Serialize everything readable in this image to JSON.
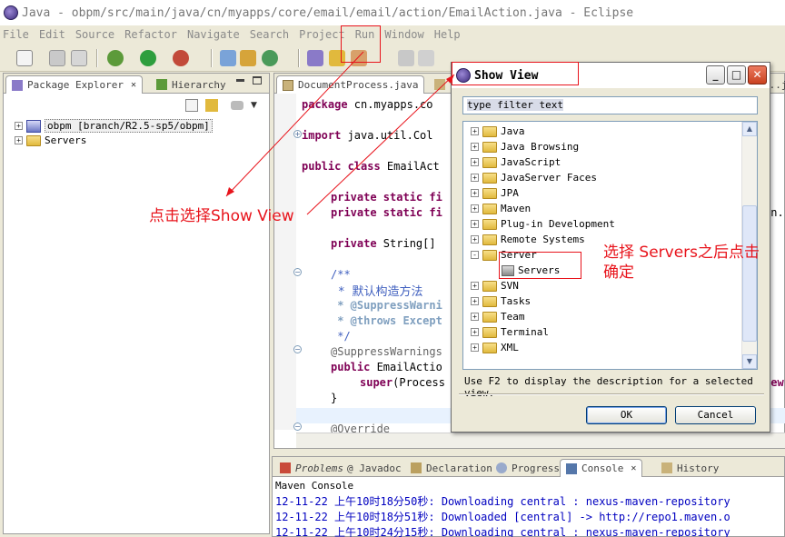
{
  "window": {
    "title": "Java - obpm/src/main/java/cn/myapps/core/email/email/action/EmailAction.java - Eclipse"
  },
  "menu": [
    "File",
    "Edit",
    "Source",
    "Refactor",
    "Navigate",
    "Search",
    "Project",
    "Run",
    "Window",
    "Help"
  ],
  "left_panel": {
    "tabs": [
      {
        "label": "Package Explorer",
        "active": true
      },
      {
        "label": "Hierarchy",
        "active": false
      }
    ],
    "tree": [
      {
        "label": "obpm [branch/R2.5-sp5/obpm]",
        "icon": "project-icon"
      },
      {
        "label": "Servers",
        "icon": "folder-icon"
      }
    ]
  },
  "editor": {
    "tabs": [
      {
        "label": "DocumentProcess.java"
      },
      {
        "label": "E..."
      },
      {
        "label": "...j"
      }
    ],
    "code": {
      "l1_kw": "package",
      "l1": " cn.myapps.co",
      "l2_kw": "import",
      "l2": " java.util.Col",
      "l3_kw": "public class",
      "l3": " EmailAct",
      "l4_kw": "private static fi",
      "l5_kw": "private static fi",
      "l5_tail": "on.",
      "l6_kw": "private",
      "l6": " String[]",
      "l7": "/**",
      "l8": " * 默认构造方法",
      "l9_tag": " * @SuppressWarni",
      "l10_tag": " * @throws Except",
      "l11": " */",
      "l12": "@SuppressWarnings",
      "l13_kw": "public",
      "l13": " EmailActio",
      "l14_kw": "super",
      "l14": "(Process",
      "l14_tail": "new",
      "l15": "}",
      "l16": "@Override"
    }
  },
  "bottom_panel": {
    "tabs": [
      "Problems",
      "@ Javadoc",
      "Declaration",
      "Progress",
      "Console",
      "History"
    ],
    "console_title": "Maven Console",
    "lines": [
      "12-11-22 上午10时18分50秒: Downloading central : nexus-maven-repository",
      "12-11-22 上午10时18分51秒: Downloaded [central] -> http://repo1.maven.o",
      "12-11-22 上午10时24分15秒: Downloading central : nexus-maven-repository"
    ]
  },
  "dialog": {
    "title": "Show View",
    "filter_text": "type filter text",
    "items": [
      {
        "label": "Java",
        "expander": "+"
      },
      {
        "label": "Java Browsing",
        "expander": "+"
      },
      {
        "label": "JavaScript",
        "expander": "+"
      },
      {
        "label": "JavaServer Faces",
        "expander": "+"
      },
      {
        "label": "JPA",
        "expander": "+"
      },
      {
        "label": "Maven",
        "expander": "+"
      },
      {
        "label": "Plug-in Development",
        "expander": "+"
      },
      {
        "label": "Remote Systems",
        "expander": "+"
      },
      {
        "label": "Server",
        "expander": "-"
      },
      {
        "label": "Servers",
        "child": true
      },
      {
        "label": "SVN",
        "expander": "+"
      },
      {
        "label": "Tasks",
        "expander": "+"
      },
      {
        "label": "Team",
        "expander": "+"
      },
      {
        "label": "Terminal",
        "expander": "+"
      },
      {
        "label": "XML",
        "expander": "+"
      }
    ],
    "hint": "Use F2 to display the description for a selected view.",
    "ok_label": "OK",
    "cancel_label": "Cancel"
  },
  "annotations": {
    "click_show_view": "点击选择Show View",
    "select_servers_1": "选择 Servers之后点击",
    "select_servers_2": "确定"
  },
  "colors": {
    "annotation": "#e8141c",
    "keyword": "#7f0055",
    "javadoc": "#3f5fbf",
    "console_text": "#0000c0"
  }
}
